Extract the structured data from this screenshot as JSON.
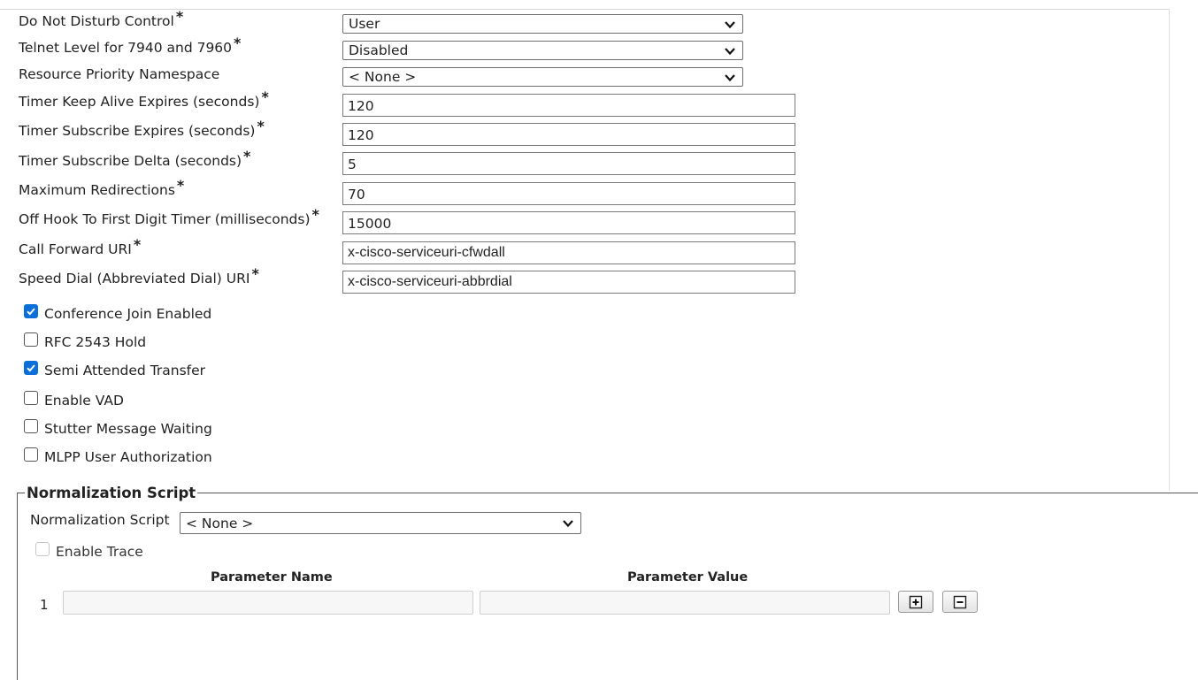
{
  "required_marker": "*",
  "fields": [
    {
      "label": "Do Not Disturb Control",
      "required": true,
      "type": "select",
      "value": "User"
    },
    {
      "label": "Telnet Level for 7940 and 7960",
      "required": true,
      "type": "select",
      "value": "Disabled"
    },
    {
      "label": "Resource Priority Namespace",
      "required": false,
      "type": "select",
      "value": "< None >"
    },
    {
      "label": "Timer Keep Alive Expires (seconds)",
      "required": true,
      "type": "text",
      "value": "120"
    },
    {
      "label": "Timer Subscribe Expires (seconds)",
      "required": true,
      "type": "text",
      "value": "120"
    },
    {
      "label": "Timer Subscribe Delta (seconds)",
      "required": true,
      "type": "text",
      "value": "5"
    },
    {
      "label": "Maximum Redirections",
      "required": true,
      "type": "text",
      "value": "70"
    },
    {
      "label": "Off Hook To First Digit Timer (milliseconds)",
      "required": true,
      "type": "text",
      "value": "15000"
    },
    {
      "label": "Call Forward URI",
      "required": true,
      "type": "text",
      "value": "x-cisco-serviceuri-cfwdall"
    },
    {
      "label": "Speed Dial (Abbreviated Dial) URI",
      "required": true,
      "type": "text",
      "value": "x-cisco-serviceuri-abbrdial"
    }
  ],
  "checkboxes": [
    {
      "label": "Conference Join Enabled",
      "checked": true
    },
    {
      "label": "RFC 2543 Hold",
      "checked": false
    },
    {
      "label": "Semi Attended Transfer",
      "checked": true
    },
    {
      "label": "Enable VAD",
      "checked": false
    },
    {
      "label": "Stutter Message Waiting",
      "checked": false
    },
    {
      "label": "MLPP User Authorization",
      "checked": false
    }
  ],
  "normalization": {
    "section_title": "Normalization Script",
    "script_label": "Normalization Script",
    "script_value": "< None >",
    "enable_trace_label": "Enable Trace",
    "enable_trace_checked": false,
    "enable_trace_disabled": true,
    "param_name_header": "Parameter Name",
    "param_value_header": "Parameter Value",
    "row_number": "1",
    "param_name": "",
    "param_value": "",
    "add_icon": "plus-box-icon",
    "remove_icon": "minus-box-icon"
  },
  "colors": {
    "checkbox_checked": "#0a6fd8",
    "border": "#6e6e6e"
  }
}
